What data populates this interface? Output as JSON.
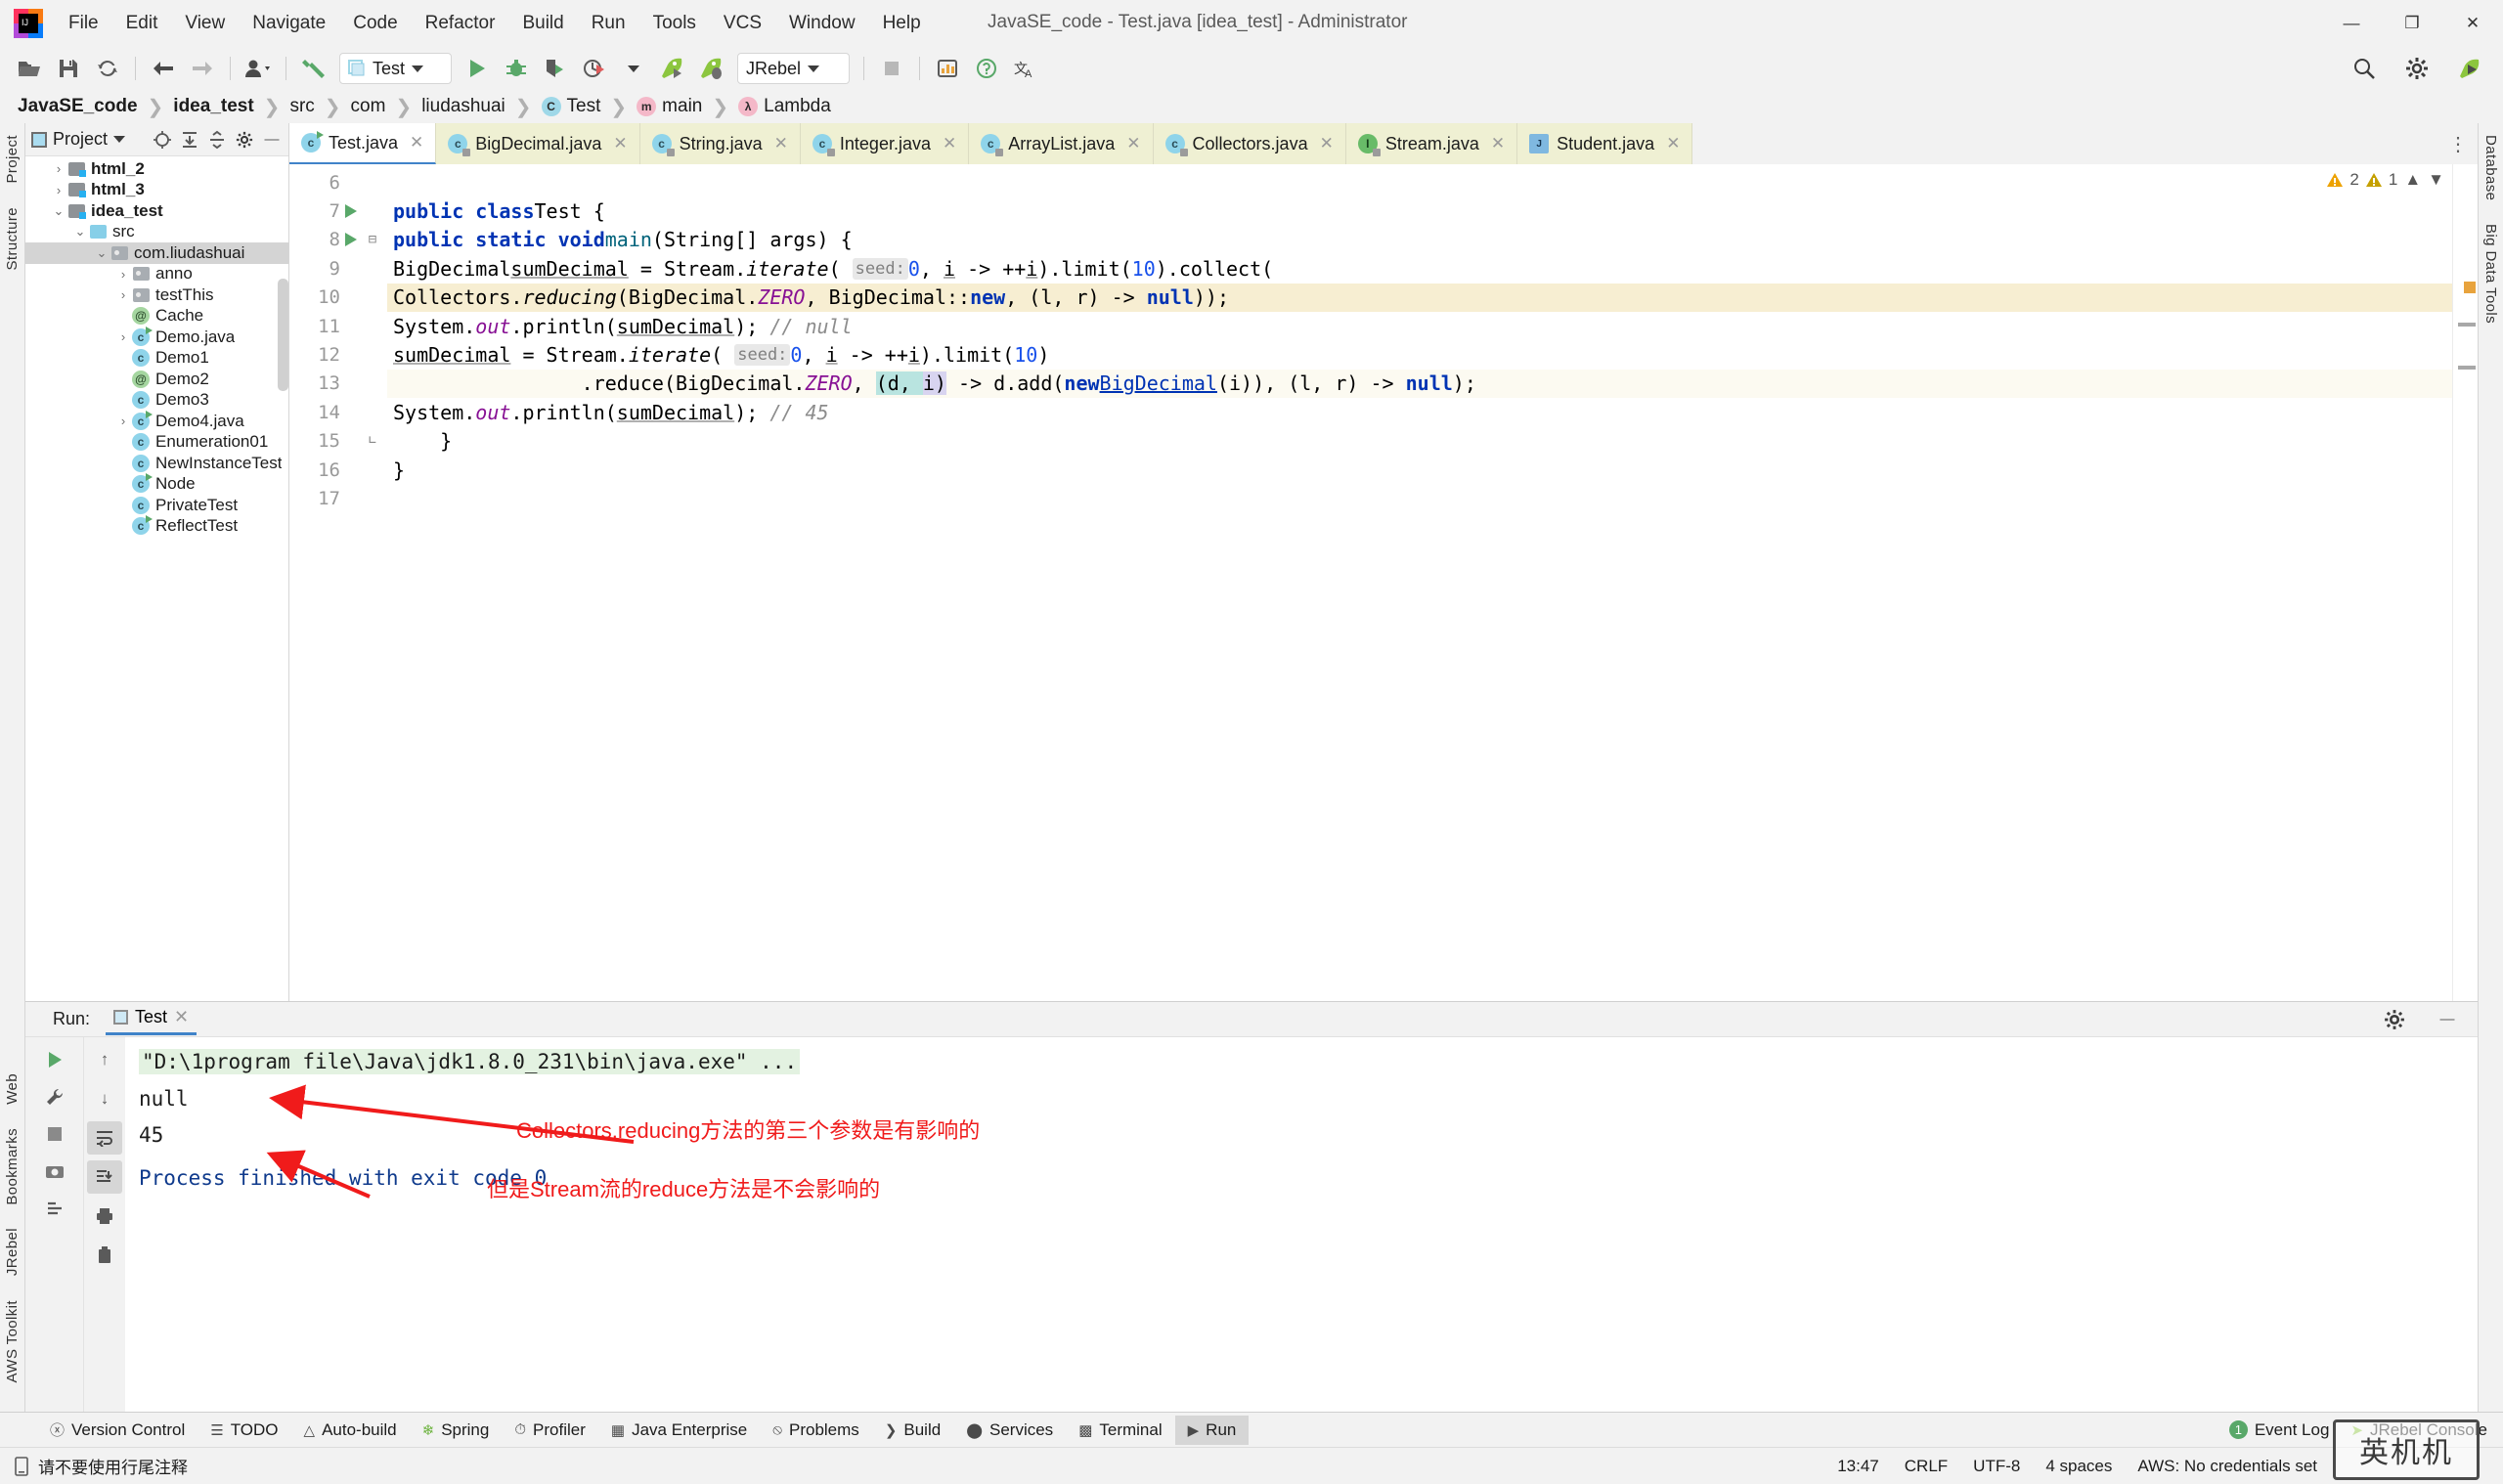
{
  "window": {
    "title": "JavaSE_code - Test.java [idea_test] - Administrator",
    "minimize": "—",
    "maximize": "❐",
    "close": "✕",
    "logo_text": "IJ"
  },
  "menubar": [
    {
      "label": "File"
    },
    {
      "label": "Edit"
    },
    {
      "label": "View"
    },
    {
      "label": "Navigate"
    },
    {
      "label": "Code"
    },
    {
      "label": "Refactor"
    },
    {
      "label": "Build"
    },
    {
      "label": "Run"
    },
    {
      "label": "Tools"
    },
    {
      "label": "VCS"
    },
    {
      "label": "Window"
    },
    {
      "label": "Help"
    }
  ],
  "toolbar": {
    "run_configuration": "Test",
    "icons": [
      "open-folder-icon",
      "save-icon",
      "sync-icon",
      "back-arrow-icon",
      "forward-arrow-icon",
      "user-icon",
      "build-hammer-icon"
    ],
    "right_icons": [
      "search-icon",
      "settings-gear-icon",
      "jrebel-play-icon"
    ],
    "jrebel_label": "JRebel"
  },
  "breadcrumb": [
    {
      "label": "JavaSE_code",
      "bold": true,
      "icon": ""
    },
    {
      "label": "idea_test",
      "bold": true,
      "icon": ""
    },
    {
      "label": "src",
      "bold": false,
      "icon": ""
    },
    {
      "label": "com",
      "bold": false,
      "icon": ""
    },
    {
      "label": "liudashuai",
      "bold": false,
      "icon": ""
    },
    {
      "label": "Test",
      "bold": false,
      "icon": "C"
    },
    {
      "label": "main",
      "bold": false,
      "icon": "m"
    },
    {
      "label": "Lambda",
      "bold": false,
      "icon": "λ"
    }
  ],
  "project_panel": {
    "title": "Project",
    "toolbar_icons": [
      "locate-target-icon",
      "expand-all-icon",
      "collapse-all-icon",
      "gear-icon",
      "hide-icon"
    ],
    "tree": [
      {
        "label": "html_2",
        "depth": 1,
        "arrow": "›",
        "icon": "module-folder",
        "bold": true
      },
      {
        "label": "html_3",
        "depth": 1,
        "arrow": "›",
        "icon": "module-folder",
        "bold": true
      },
      {
        "label": "idea_test",
        "depth": 1,
        "arrow": "⌄",
        "icon": "module-folder",
        "bold": true
      },
      {
        "label": "src",
        "depth": 2,
        "arrow": "⌄",
        "icon": "source-folder",
        "bold": false
      },
      {
        "label": "com.liudashuai",
        "depth": 3,
        "arrow": "⌄",
        "icon": "package-folder",
        "bold": false,
        "selected": true
      },
      {
        "label": "anno",
        "depth": 4,
        "arrow": "›",
        "icon": "package-folder",
        "bold": false
      },
      {
        "label": "testThis",
        "depth": 4,
        "arrow": "›",
        "icon": "package-folder",
        "bold": false
      },
      {
        "label": "Cache",
        "depth": 4,
        "arrow": "",
        "icon": "annotation",
        "bold": false
      },
      {
        "label": "Demo.java",
        "depth": 4,
        "arrow": "›",
        "icon": "class-runnable",
        "bold": false
      },
      {
        "label": "Demo1",
        "depth": 4,
        "arrow": "",
        "icon": "class",
        "bold": false
      },
      {
        "label": "Demo2",
        "depth": 4,
        "arrow": "",
        "icon": "annotation",
        "bold": false
      },
      {
        "label": "Demo3",
        "depth": 4,
        "arrow": "",
        "icon": "class",
        "bold": false
      },
      {
        "label": "Demo4.java",
        "depth": 4,
        "arrow": "›",
        "icon": "class-runnable",
        "bold": false
      },
      {
        "label": "Enumeration01",
        "depth": 4,
        "arrow": "",
        "icon": "class",
        "bold": false
      },
      {
        "label": "NewInstanceTest",
        "depth": 4,
        "arrow": "",
        "icon": "class",
        "bold": false
      },
      {
        "label": "Node",
        "depth": 4,
        "arrow": "",
        "icon": "class-runnable",
        "bold": false
      },
      {
        "label": "PrivateTest",
        "depth": 4,
        "arrow": "",
        "icon": "class",
        "bold": false
      },
      {
        "label": "ReflectTest",
        "depth": 4,
        "arrow": "",
        "icon": "class-runnable",
        "bold": false
      }
    ]
  },
  "left_rail": [
    "Project",
    "Structure",
    "Bookmarks"
  ],
  "left_rail_bottom": [
    "Web",
    "Bookmarks",
    "JRebel",
    "AWS Toolkit"
  ],
  "right_rail": [
    "Database",
    "Big Data Tools"
  ],
  "editor": {
    "tabs": [
      {
        "label": "Test.java",
        "icon": "class-runnable",
        "active": true
      },
      {
        "label": "BigDecimal.java",
        "icon": "class-lock",
        "active": false
      },
      {
        "label": "String.java",
        "icon": "class-lock",
        "active": false
      },
      {
        "label": "Integer.java",
        "icon": "class-lock",
        "active": false
      },
      {
        "label": "ArrayList.java",
        "icon": "class-lock",
        "active": false
      },
      {
        "label": "Collectors.java",
        "icon": "class-lock",
        "active": false
      },
      {
        "label": "Stream.java",
        "icon": "interface-lock",
        "active": false
      },
      {
        "label": "Student.java",
        "icon": "java-file",
        "active": false
      }
    ],
    "inspection": {
      "warnings": "2",
      "weak_warnings": "1"
    },
    "line_numbers": [
      "6",
      "7",
      "8",
      "9",
      "10",
      "11",
      "12",
      "13",
      "14",
      "15",
      "16",
      "17"
    ],
    "code_lines": [
      "",
      "public class Test {",
      "    public static void main(String[] args) {",
      "        BigDecimal sumDecimal = Stream.iterate( seed: 0, i -> ++i).limit(10).collect(",
      "                Collectors.reducing(BigDecimal.ZERO, BigDecimal::new, (l, r) -> null));",
      "        System.out.println(sumDecimal); // null",
      "        sumDecimal = Stream.iterate( seed: 0, i -> ++i).limit(10)",
      "                .reduce(BigDecimal.ZERO, (d, i) -> d.add(new BigDecimal(i)), (l, r) -> null);",
      "        System.out.println(sumDecimal); // 45",
      "    }",
      "}",
      ""
    ]
  },
  "run_panel": {
    "label": "Run:",
    "tab": "Test",
    "left_buttons": [
      "rerun-icon",
      "wrench-icon",
      "stop-icon",
      "camera-icon",
      "restore-layout-icon"
    ],
    "nav_buttons": [
      "up-arrow-icon",
      "down-arrow-icon",
      "soft-wrap-icon",
      "scroll-to-end-icon",
      "print-icon",
      "trash-icon"
    ],
    "console": {
      "command": "\"D:\\1program file\\Java\\jdk1.8.0_231\\bin\\java.exe\" ...",
      "out1": "null",
      "out2": "45",
      "exit": "Process finished with exit code 0"
    },
    "annotations": [
      "Collectors.reducing方法的第三个参数是有影响的",
      "但是Stream流的reduce方法是不会影响的"
    ],
    "settings_icon": "gear-icon",
    "hide_icon": "minimize-icon"
  },
  "toolwindow_bar": {
    "items": [
      {
        "label": "Version Control",
        "icon": "branch-icon",
        "active": false
      },
      {
        "label": "TODO",
        "icon": "list-icon",
        "active": false
      },
      {
        "label": "Auto-build",
        "icon": "warning-triangle-icon",
        "active": false
      },
      {
        "label": "Spring",
        "icon": "leaf-icon",
        "active": false
      },
      {
        "label": "Profiler",
        "icon": "profiler-icon",
        "active": false
      },
      {
        "label": "Java Enterprise",
        "icon": "enterprise-icon",
        "active": false
      },
      {
        "label": "Problems",
        "icon": "problems-icon",
        "active": false
      },
      {
        "label": "Build",
        "icon": "hammer-icon",
        "active": false
      },
      {
        "label": "Services",
        "icon": "services-icon",
        "active": false
      },
      {
        "label": "Terminal",
        "icon": "terminal-icon",
        "active": false
      },
      {
        "label": "Run",
        "icon": "run-triangle-icon",
        "active": true
      }
    ],
    "event_log": {
      "label": "Event Log",
      "count": "1"
    },
    "jrebel_console": "JRebel Console"
  },
  "statusbar": {
    "message": "请不要使用行尾注释",
    "message_icon": "notification-icon",
    "position": "13:47",
    "line_sep": "CRLF",
    "encoding": "UTF-8",
    "indent": "4 spaces",
    "aws": "AWS: No credentials set"
  },
  "watermark": "英机机"
}
